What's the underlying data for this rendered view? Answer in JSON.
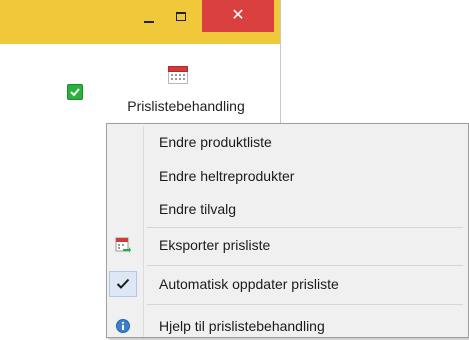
{
  "window": {
    "titlebar_color": "#f0c93a",
    "close_color": "#d9403f",
    "minimize_icon": "minimize-icon",
    "maximize_icon": "maximize-icon",
    "close_icon": "close-icon",
    "close_glyph": "✕"
  },
  "ribbon": {
    "status_icon": "green-check-icon",
    "prisliste_button": {
      "label": "Prislistebehandling",
      "icon": "calendar-icon"
    }
  },
  "menu": {
    "items": [
      {
        "label": "Endre produktliste",
        "icon": null
      },
      {
        "label": "Endre heltreprodukter",
        "icon": null
      },
      {
        "label": "Endre tilvalg",
        "icon": null
      },
      {
        "label": "Eksporter prisliste",
        "icon": "export-pricelist-icon"
      },
      {
        "label": "Automatisk oppdater prisliste",
        "icon": "checkmark-icon",
        "checked": true
      },
      {
        "label": "Hjelp til prislistebehandling",
        "icon": "info-icon"
      }
    ]
  }
}
